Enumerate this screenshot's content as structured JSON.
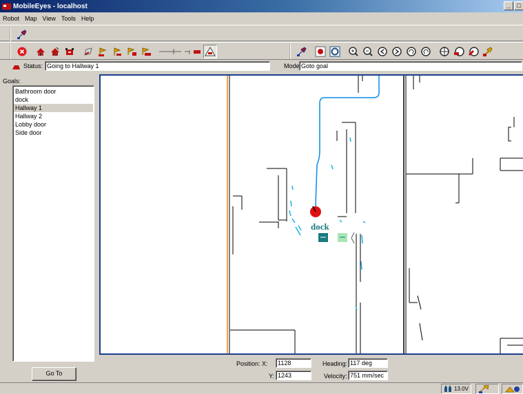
{
  "window": {
    "title": "MobileEyes - localhost",
    "min_glyph": "_",
    "close_glyph": "□"
  },
  "menu": [
    "Robot",
    "Map",
    "View",
    "Tools",
    "Help"
  ],
  "toolbar": {
    "row1": [
      "connect-icon"
    ],
    "row2_left": [
      "stop-icon",
      "home-icon",
      "dock-icon",
      "robot-icon",
      "goal-icon",
      "goal-sequence-icon",
      "goal-arrow-icon",
      "tour-icon",
      "wander-icon",
      "path-icon",
      "joystick-icon",
      "warning-icon"
    ],
    "row2_right": [
      "map-icon",
      "record-icon",
      "camera-icon",
      "zoom-in-icon",
      "zoom-out-icon",
      "pan-left-icon",
      "pan-right-icon",
      "rotate-left-icon",
      "rotate-right-icon",
      "center-icon",
      "follow-icon",
      "dock-view-icon",
      "options-icon"
    ]
  },
  "status": {
    "label": "Status:",
    "value": "Going to Hallway 1",
    "mode_label": "Mode:",
    "mode_value": "Goto goal"
  },
  "goals": {
    "label": "Goals:",
    "items": [
      "Bathroom door",
      "dock",
      "Hallway 1",
      "Hallway 2",
      "Lobby door",
      "Side door"
    ],
    "selected": "Hallway 1",
    "goto_label": "Go To"
  },
  "map": {
    "dock_label": "dock",
    "colors": {
      "wall": "#000000",
      "path": "#0a8ae6",
      "laser": "#1ab0e6",
      "robot": "#e01010",
      "boundary": "#f08010",
      "dock": "#1a7a80",
      "dock_light": "#a8e6b8"
    }
  },
  "position": {
    "x_label": "Position:  X:",
    "x_value": "1128",
    "y_label": "Y:",
    "y_value": "1243",
    "heading_label": "Heading:",
    "heading_value": "117 deg",
    "velocity_label": "Velocity:",
    "velocity_value": "751 mm/sec"
  },
  "footer": {
    "battery": "13.0V"
  }
}
